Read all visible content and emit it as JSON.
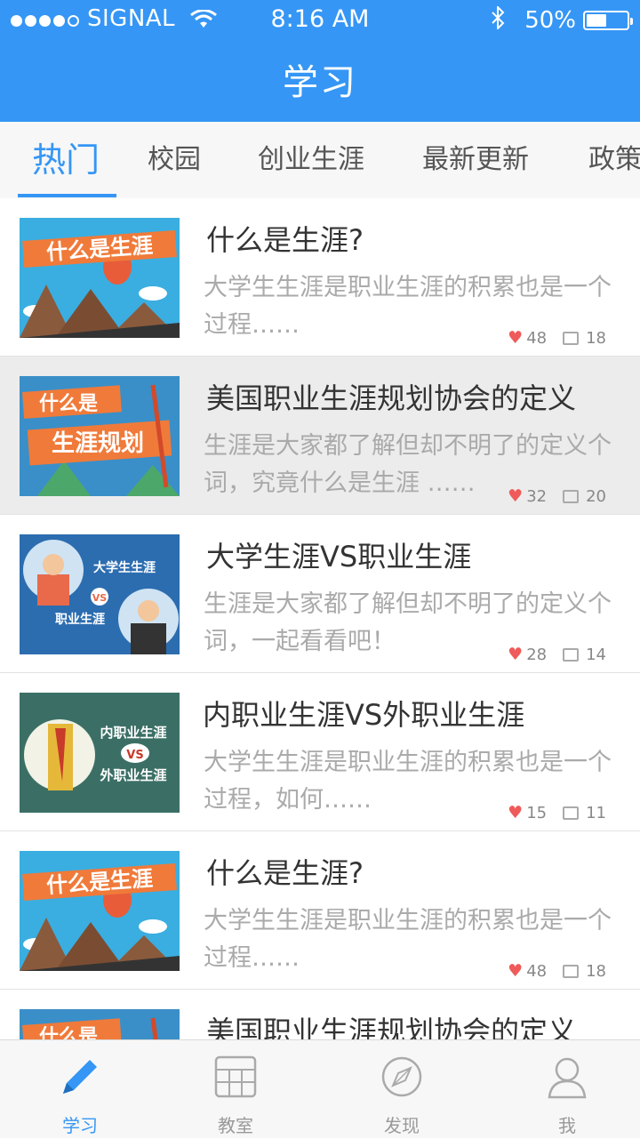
{
  "status_bar": {
    "carrier": "SIGNAL",
    "time": "8:16 AM",
    "battery": "50%"
  },
  "header": {
    "title": "学习"
  },
  "tabs": [
    {
      "label": "热门"
    },
    {
      "label": "校园"
    },
    {
      "label": "创业生涯"
    },
    {
      "label": "最新更新"
    },
    {
      "label": "政策"
    }
  ],
  "articles": [
    {
      "title": "什么是生涯?",
      "desc": "大学生生涯是职业生涯的积累也是一个过程……",
      "likes": "48",
      "comments": "18",
      "thumb_text": [
        "什么是生涯"
      ]
    },
    {
      "title": "美国职业生涯规划协会的定义",
      "desc": "生涯是大家都了解但却不明了的定义个词，究竟什么是生涯 ……",
      "likes": "32",
      "comments": "20",
      "thumb_text": [
        "什么是",
        "生涯规划"
      ]
    },
    {
      "title": "大学生涯VS职业生涯",
      "desc": "生涯是大家都了解但却不明了的定义个词，一起看看吧！",
      "likes": "28",
      "comments": "14",
      "thumb_text": [
        "大学生生涯",
        "VS",
        "职业生涯"
      ]
    },
    {
      "title": "内职业生涯VS外职业生涯",
      "desc": "大学生生涯是职业生涯的积累也是一个过程，如何……",
      "likes": "15",
      "comments": "11",
      "thumb_text": [
        "内职业生涯",
        "VS",
        "外职业生涯"
      ]
    },
    {
      "title": "什么是生涯?",
      "desc": "大学生生涯是职业生涯的积累也是一个过程……",
      "likes": "48",
      "comments": "18",
      "thumb_text": [
        "什么是生涯"
      ]
    },
    {
      "title": "美国职业生涯规划协会的定义",
      "desc": "",
      "likes": "",
      "comments": "",
      "thumb_text": [
        "什么是"
      ]
    }
  ],
  "bottom_nav": [
    {
      "label": "学习",
      "icon": "pencil-icon"
    },
    {
      "label": "教室",
      "icon": "grid-icon"
    },
    {
      "label": "发现",
      "icon": "compass-icon"
    },
    {
      "label": "我",
      "icon": "person-icon"
    }
  ],
  "colors": {
    "accent": "#3596f5",
    "like": "#ef5a5a"
  }
}
